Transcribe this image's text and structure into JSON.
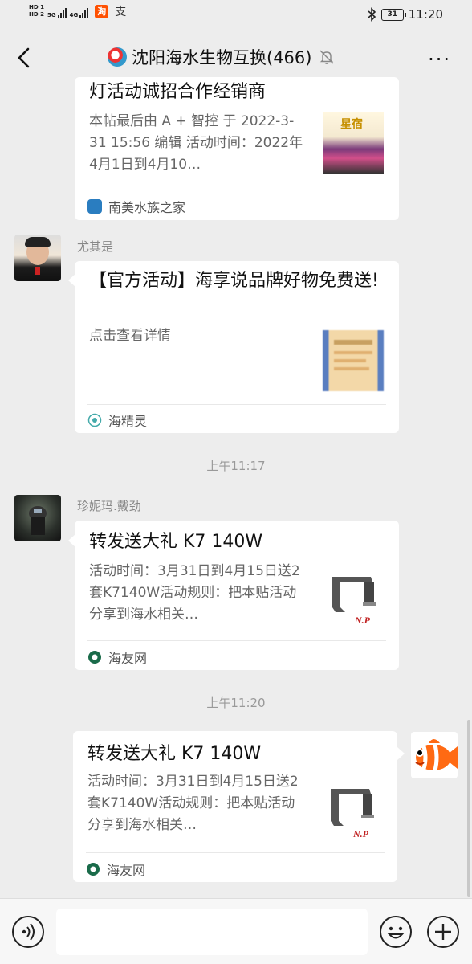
{
  "status_bar": {
    "hd1": "HD 1",
    "hd2": "HD 2",
    "net1": "5G",
    "net2": "4G",
    "taobao_icon": "taobao-icon",
    "taobao_label": "淘",
    "alipay_label": "支",
    "bluetooth_icon": "bluetooth-icon",
    "battery": "31",
    "time": "11:20"
  },
  "header": {
    "title": "沈阳海水生物互换(466)",
    "back_icon": "chevron-left-icon",
    "mute_icon": "bell-off-icon",
    "more_label": "···"
  },
  "messages": [
    {
      "title": "灯活动诚招合作经销商",
      "desc": "本帖最后由 A + 智控 于 2022-3-31 15:56 编辑 活动时间：2022年4月1日到4月10…",
      "source": "南美水族之家"
    },
    {
      "sender": "尤其是",
      "title": "【官方活动】海享说品牌好物免费送!",
      "desc": "点击查看详情",
      "source": "海精灵"
    },
    {
      "time": "上午11:17",
      "sender": "珍妮玛.戴劲",
      "title": "转发送大礼 K7 140W",
      "desc": "活动时间：3月31日到4月15日送2套K7140W活动规则：把本贴活动分享到海水相关…",
      "source": "海友网"
    },
    {
      "time": "上午11:20",
      "title": "转发送大礼 K7 140W",
      "desc": "活动时间：3月31日到4月15日送2套K7140W活动规则：把本贴活动分享到海水相关…",
      "source": "海友网"
    }
  ],
  "thumb_labels": {
    "xingsu": "星宿",
    "np": "N.P"
  },
  "input_bar": {
    "voice_icon": "voice-icon",
    "emoji_icon": "emoji-icon",
    "plus_icon": "plus-icon"
  },
  "colors": {
    "background": "#ededed",
    "card": "#ffffff",
    "source_green": "#1aad19"
  }
}
